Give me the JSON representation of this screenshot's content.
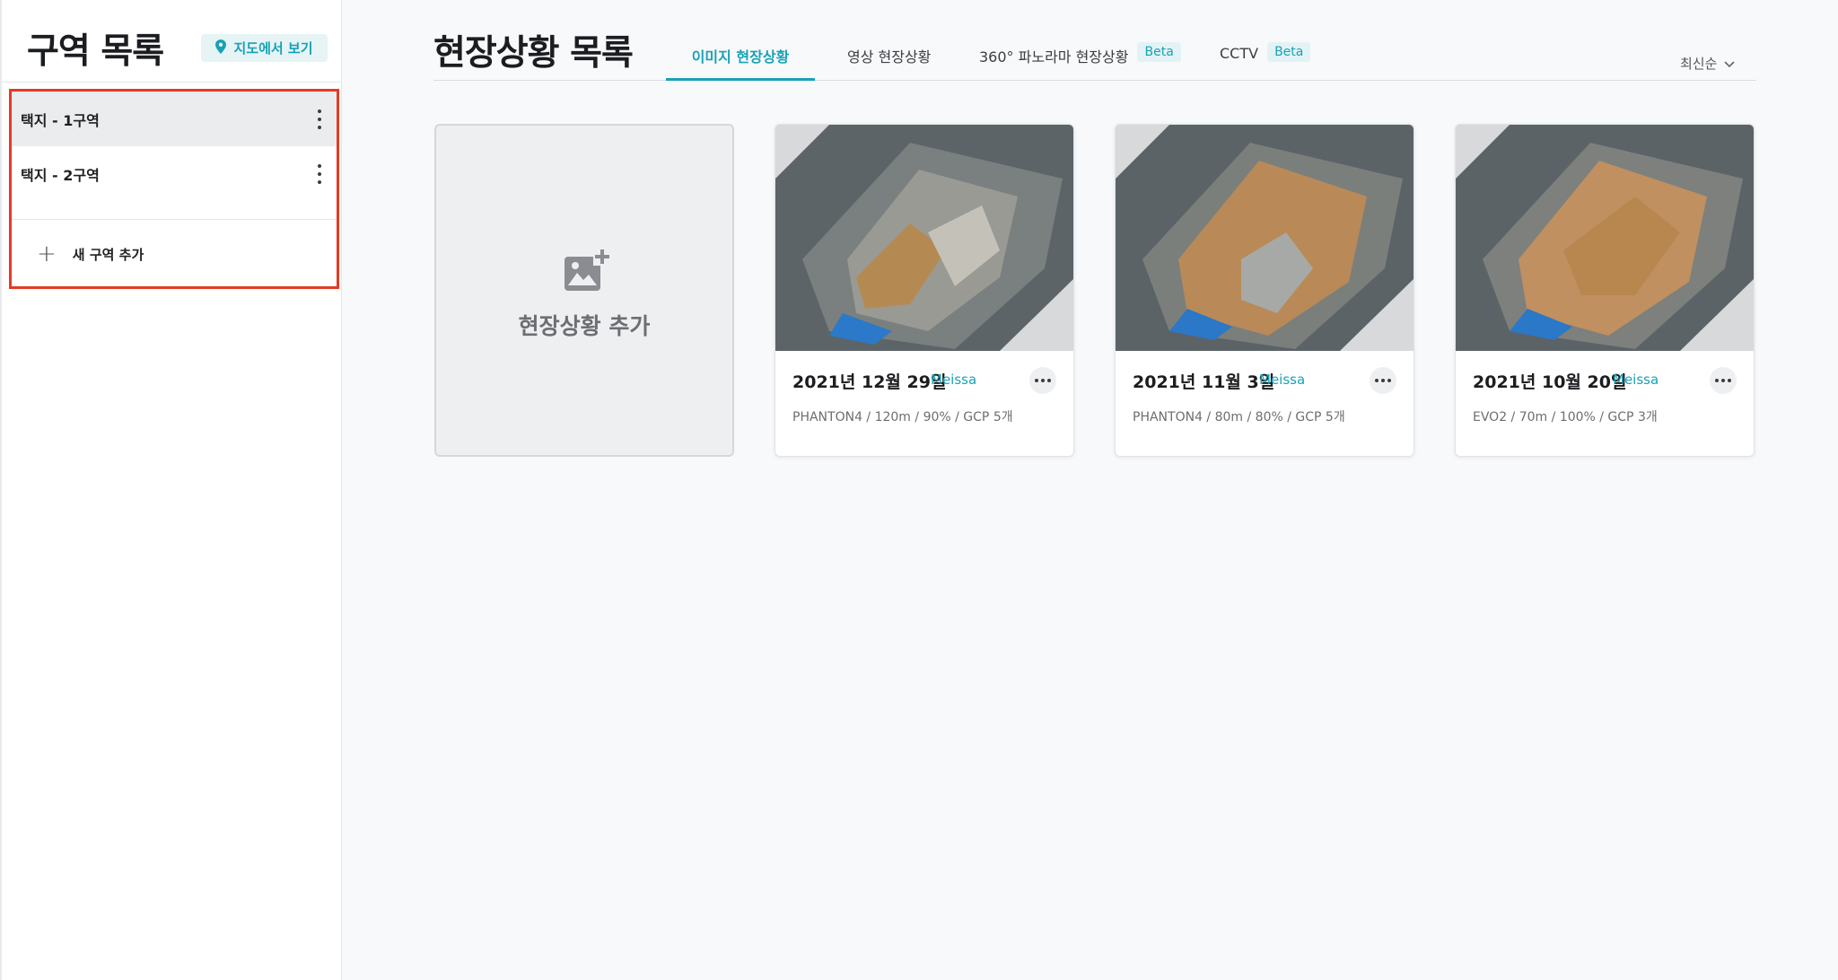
{
  "sidebar": {
    "title": "구역 목록",
    "map_view_label": "지도에서 보기",
    "zones": [
      {
        "label": "택지 - 1구역",
        "active": true
      },
      {
        "label": "택지 - 2구역",
        "active": false
      }
    ],
    "add_zone_label": "새 구역 추가"
  },
  "main": {
    "title": "현장상황 목록",
    "tabs": [
      {
        "label": "이미지 현장상황",
        "active": true,
        "badge": ""
      },
      {
        "label": "영상 현장상황",
        "active": false,
        "badge": ""
      },
      {
        "label": "360° 파노라마 현장상황",
        "active": false,
        "badge": "Beta"
      },
      {
        "label": "CCTV",
        "active": false,
        "badge": "Beta"
      }
    ],
    "sort_label": "최신순",
    "add_card_label": "현장상황 추가",
    "cards": [
      {
        "date": "2021년 12월 29일",
        "author": "Meissa",
        "meta": "PHANTON4 / 120m / 90% / GCP 5개"
      },
      {
        "date": "2021년 11월 3일",
        "author": "Meissa",
        "meta": "PHANTON4 / 80m / 80% / GCP 5개"
      },
      {
        "date": "2021년 10월 20일",
        "author": "Meissa",
        "meta": "EVO2 / 70m / 100% / GCP 3개"
      }
    ]
  },
  "colors": {
    "accent": "#19a2b6",
    "highlight_border": "#e63a23",
    "active_row": "#ebecee"
  },
  "icons": [
    "map-pin-icon",
    "kebab-menu-icon",
    "plus-icon",
    "add-photo-icon",
    "chevron-down-icon",
    "more-horizontal-icon"
  ]
}
